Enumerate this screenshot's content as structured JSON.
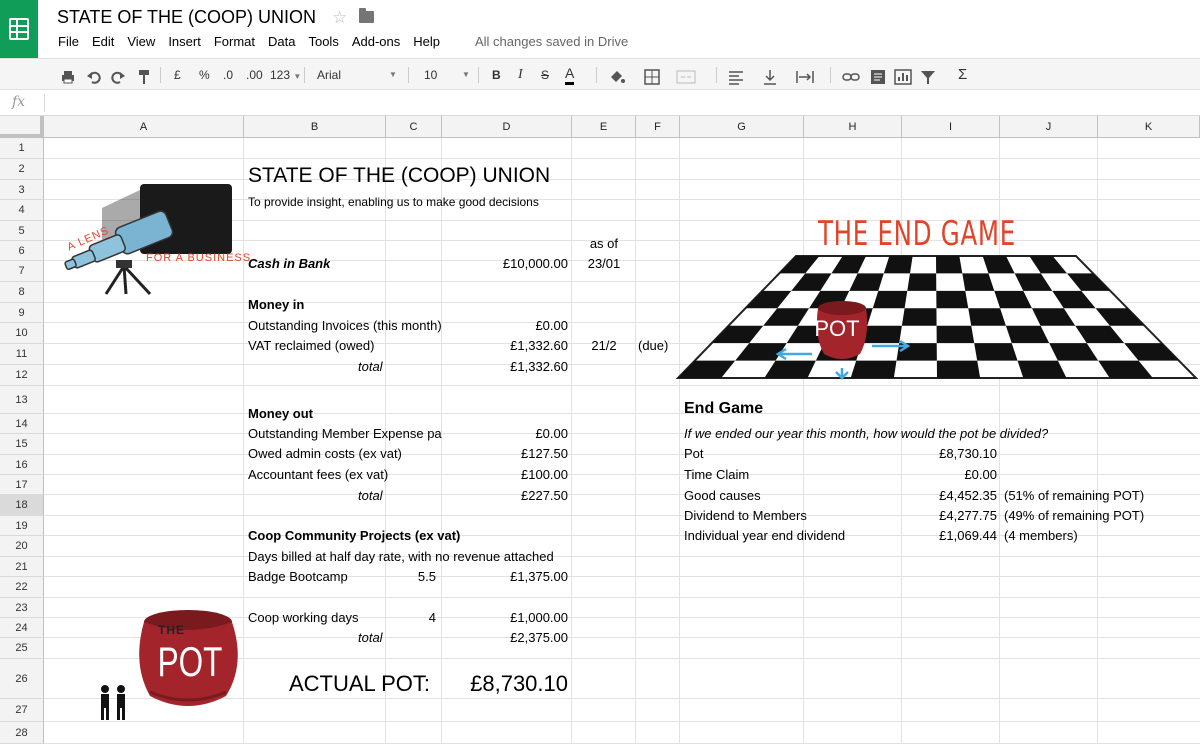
{
  "app": {
    "doc_title": "STATE OF THE (COOP) UNION",
    "menu": [
      "File",
      "Edit",
      "View",
      "Insert",
      "Format",
      "Data",
      "Tools",
      "Add-ons",
      "Help"
    ],
    "save_status": "All changes saved in Drive",
    "accent": "#0f9d58"
  },
  "toolbar": {
    "currency": "£",
    "percent": "%",
    "dec_less": ".0",
    "dec_more": ".00",
    "format_more": "123",
    "font": "Arial",
    "size": "10",
    "bold": "B",
    "italic": "I",
    "strike": "S",
    "text_color": "A",
    "sum": "Σ"
  },
  "formula_bar": {
    "fx": "fx",
    "value": ""
  },
  "columns": [
    "A",
    "B",
    "C",
    "D",
    "E",
    "F",
    "G",
    "H",
    "I",
    "J",
    "K"
  ],
  "rows": [
    "1",
    "2",
    "3",
    "4",
    "5",
    "6",
    "7",
    "8",
    "9",
    "10",
    "11",
    "12",
    "13",
    "14",
    "15",
    "16",
    "17",
    "18",
    "19",
    "20",
    "21",
    "22",
    "23",
    "24",
    "25",
    "26",
    "27",
    "28"
  ],
  "sheet": {
    "title": "STATE OF THE (COOP) UNION",
    "subtitle": "To provide insight, enabling us to make good decisions",
    "as_of_label": "as of",
    "cash_label": "Cash in Bank",
    "cash_value": "£10,000.00",
    "cash_date": "23/01",
    "money_in": "Money in",
    "inv_label": "Outstanding Invoices (this month)",
    "inv_value": "£0.00",
    "vat_label": "VAT reclaimed (owed)",
    "vat_value": "£1,332.60",
    "vat_date": "21/2",
    "vat_due": "(due)",
    "in_total_label": "total",
    "in_total": "£1,332.60",
    "money_out": "Money out",
    "exp_label": "Outstanding Member Expense pay",
    "exp_value": "£0.00",
    "admin_label": "Owed admin costs (ex vat)",
    "admin_value": "£127.50",
    "acc_label": "Accountant fees (ex vat)",
    "acc_value": "£100.00",
    "out_total_label": "total",
    "out_total": "£227.50",
    "coop_projects": "Coop Community Projects (ex vat)",
    "days_note": "Days billed at half day rate, with no revenue attached",
    "badge_label": "Badge Bootcamp",
    "badge_days": "5.5",
    "badge_value": "£1,375.00",
    "coop_days_label": "Coop working days",
    "coop_days": "4",
    "coop_days_value": "£1,000.00",
    "proj_total_label": "total",
    "proj_total": "£2,375.00",
    "actual_pot_label": "ACTUAL POT:",
    "actual_pot_value": "£8,730.10",
    "end_game": "End Game",
    "end_game_q": "If we ended our year this month, how would the pot be divided?",
    "pot_label": "Pot",
    "pot_value": "£8,730.10",
    "time_label": "Time Claim",
    "time_value": "£0.00",
    "good_label": "Good causes",
    "good_value": "£4,452.35",
    "good_note": "(51% of remaining POT)",
    "div_label": "Dividend to Members",
    "div_value": "£4,277.75",
    "div_note": "(49% of remaining POT)",
    "ind_label": "Individual year end dividend",
    "ind_value": "£1,069.44",
    "ind_note": "(4 members)"
  },
  "illustrations": {
    "lens_text1": "A LENS",
    "lens_text2": "FOR A BUSINESS",
    "end_game_title": "THE END GAME",
    "pot_word": "POT",
    "the_word": "THE",
    "pot_word2": "POT",
    "pot_color": "#a3252b",
    "orange": "#e0452a",
    "telescope_blue": "#7bb3d2"
  }
}
